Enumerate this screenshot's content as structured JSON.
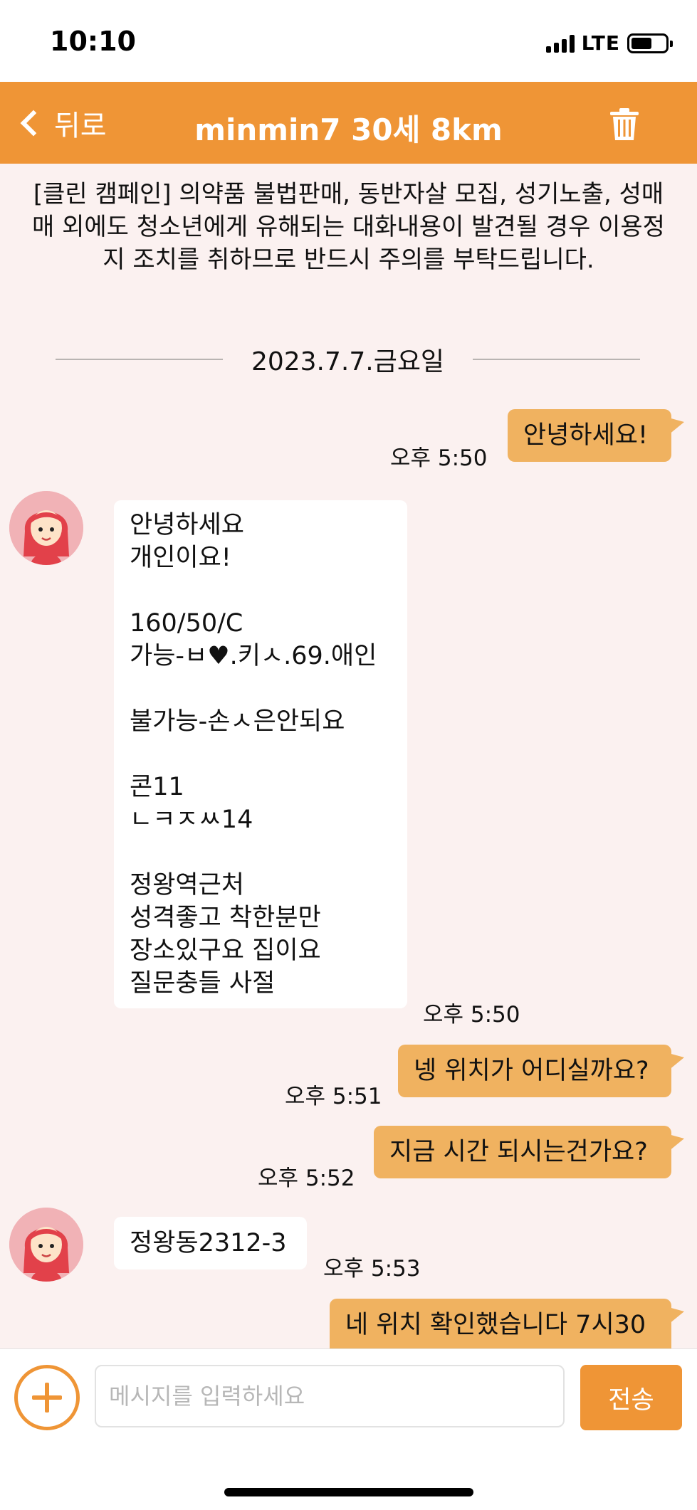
{
  "status_bar": {
    "time": "10:10",
    "network": "LTE",
    "battery_icon": "battery-icon",
    "signal_icon": "signal-icon"
  },
  "nav": {
    "back_label": "뒤로",
    "title": "minmin7 30세 8km",
    "trash_icon": "trash-icon",
    "accent_color": "#ef9536"
  },
  "notice": "[클린 캠페인] 의약품 불법판매, 동반자살 모집, 성기노출, 성매매 외에도 청소년에게 유해되는 대화내용이 발견될 경우 이용정지 조치를 취하므로 반드시 주의를 부탁드립니다.",
  "date_divider": "2023.7.7.금요일",
  "messages": [
    {
      "from": "me",
      "text": "안녕하세요!",
      "time": "오후 5:50"
    },
    {
      "from": "them",
      "text": "안녕하세요\n개인이요!\n\n160/50/C\n가능-ㅂ♥.키ㅅ.69.애인\n\n불가능-손ㅅ은안되요\n\n콘11\nㄴㅋㅈㅆ14\n\n정왕역근처\n성격좋고 착한분만\n장소있구요 집이요\n질문충들 사절",
      "time": "오후 5:50"
    },
    {
      "from": "me",
      "text": "넹 위치가 어디실까요?",
      "time": "오후 5:51"
    },
    {
      "from": "me",
      "text": "지금 시간 되시는건가요?",
      "time": "오후 5:52"
    },
    {
      "from": "them",
      "text": "정왕동2312-3",
      "time": "오후 5:53"
    },
    {
      "from": "me",
      "text": "네 위치 확인했습니다 7시30",
      "time": ""
    }
  ],
  "input": {
    "placeholder": "메시지를 입력하세요",
    "value": "",
    "send_label": "전송",
    "plus_icon": "plus-icon"
  }
}
